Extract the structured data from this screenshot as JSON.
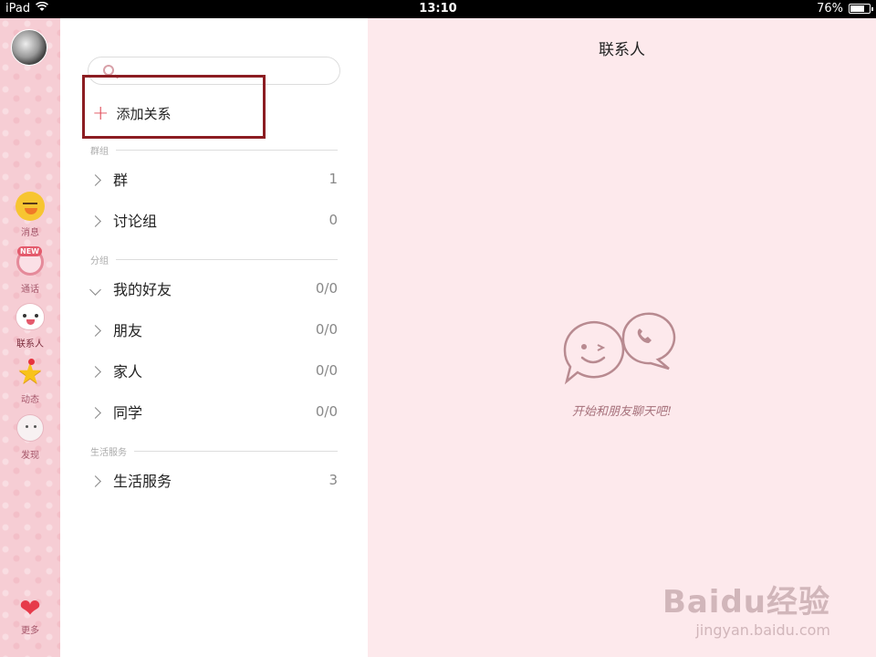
{
  "status_bar": {
    "device": "iPad",
    "time": "13:10",
    "battery": "76%",
    "battery_level": 0.76
  },
  "sidebar": {
    "items": [
      {
        "label": "消息",
        "icon": "duck-icon"
      },
      {
        "label": "通话",
        "icon": "phone-icon",
        "badge": "NEW"
      },
      {
        "label": "联系人",
        "icon": "cat-icon",
        "active": true
      },
      {
        "label": "动态",
        "icon": "star-icon",
        "dot": true
      },
      {
        "label": "发现",
        "icon": "blob-icon"
      }
    ],
    "more_label": "更多"
  },
  "list": {
    "search_placeholder": "",
    "add_contact_label": "添加关系",
    "sections": [
      {
        "title": "群组",
        "rows": [
          {
            "label": "群",
            "count": "1",
            "expanded": false
          },
          {
            "label": "讨论组",
            "count": "0",
            "expanded": false
          }
        ]
      },
      {
        "title": "分组",
        "rows": [
          {
            "label": "我的好友",
            "count": "0/0",
            "expanded": true
          },
          {
            "label": "朋友",
            "count": "0/0",
            "expanded": false
          },
          {
            "label": "家人",
            "count": "0/0",
            "expanded": false
          },
          {
            "label": "同学",
            "count": "0/0",
            "expanded": false
          }
        ]
      },
      {
        "title": "生活服务",
        "rows": [
          {
            "label": "生活服务",
            "count": "3",
            "expanded": false
          }
        ]
      }
    ]
  },
  "detail": {
    "title": "联系人",
    "empty_text": "开始和朋友聊天吧!"
  },
  "watermark": {
    "main": "Baidu经验",
    "sub": "jingyan.baidu.com"
  },
  "colors": {
    "rail_bg": "#f6cdd4",
    "detail_bg": "#fde9ec",
    "highlight_box": "#8c1d22",
    "accent_red": "#e04b58"
  }
}
